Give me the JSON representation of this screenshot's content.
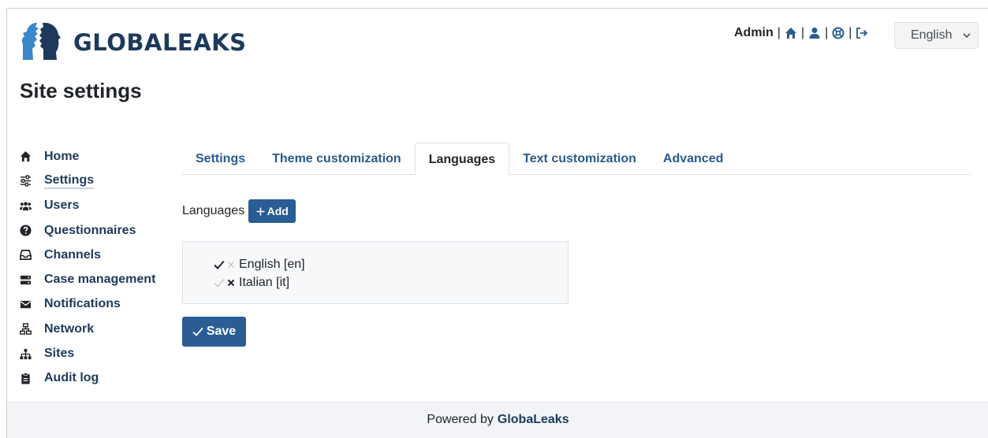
{
  "brand": {
    "name": "GLOBALEAKS"
  },
  "page": {
    "title": "Site settings"
  },
  "topbar": {
    "user": "Admin",
    "icons": [
      "home-icon",
      "user-icon",
      "support-icon",
      "logout-icon"
    ],
    "language_selected": "English"
  },
  "sidebar": {
    "items": [
      {
        "label": "Home",
        "icon": "home-icon"
      },
      {
        "label": "Settings",
        "icon": "sliders-icon",
        "active": true
      },
      {
        "label": "Users",
        "icon": "users-icon"
      },
      {
        "label": "Questionnaires",
        "icon": "question-circle-icon"
      },
      {
        "label": "Channels",
        "icon": "inbox-icon"
      },
      {
        "label": "Case management",
        "icon": "server-icon"
      },
      {
        "label": "Notifications",
        "icon": "envelope-icon"
      },
      {
        "label": "Network",
        "icon": "network-icon"
      },
      {
        "label": "Sites",
        "icon": "sitemap-icon"
      },
      {
        "label": "Audit log",
        "icon": "clipboard-icon"
      }
    ]
  },
  "tabs": [
    {
      "label": "Settings"
    },
    {
      "label": "Theme customization"
    },
    {
      "label": "Languages",
      "active": true
    },
    {
      "label": "Text customization"
    },
    {
      "label": "Advanced"
    }
  ],
  "languages": {
    "label": "Languages",
    "add_label": "Add",
    "list": [
      {
        "name": "English [en]",
        "enabled": true
      },
      {
        "name": "Italian [it]",
        "enabled": false
      }
    ]
  },
  "save_label": "Save",
  "footer": {
    "prefix": "Powered by",
    "link": "GlobaLeaks"
  },
  "colors": {
    "primary": "#2a5d93",
    "brand_dark": "#1d3a5c",
    "footer_bg": "#f2f4f7"
  }
}
